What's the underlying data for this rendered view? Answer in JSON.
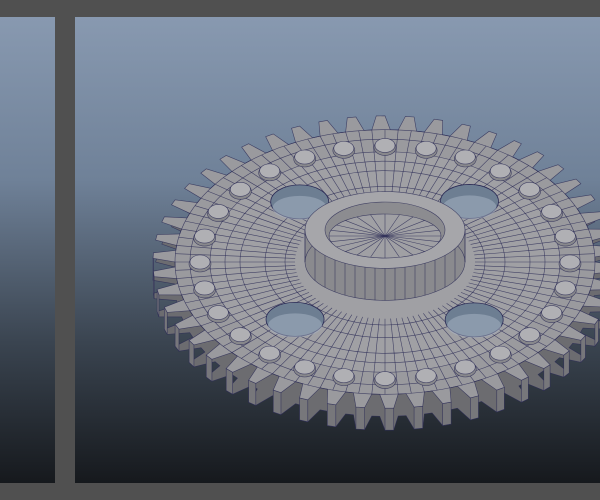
{
  "viewport": {
    "gradient_top": "#8899b0",
    "gradient_bottom": "#16191d",
    "frame_color": "#505050"
  },
  "model": {
    "name": "gear",
    "teeth": 50,
    "bolts": 28,
    "holes": 4,
    "face_color": "#9a9a9e",
    "side_color": "#6c6c70",
    "wire_color": "#2a2a55"
  }
}
